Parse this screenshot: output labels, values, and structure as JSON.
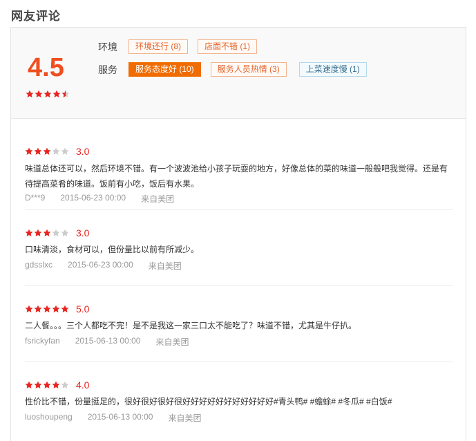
{
  "section": {
    "title": "网友评论"
  },
  "summary": {
    "score": "4.5",
    "score_rating": 4.5,
    "categories": [
      {
        "label": "环境",
        "tags": [
          {
            "text": "环境还行 (8)",
            "state": "normal"
          },
          {
            "text": "店面不错 (1)",
            "state": "normal"
          }
        ]
      },
      {
        "label": "服务",
        "tags": [
          {
            "text": "服务态度好 (10)",
            "state": "active"
          },
          {
            "text": "服务人员热情 (3)",
            "state": "normal"
          },
          {
            "text": "上菜速度慢 (1)",
            "state": "negative"
          }
        ]
      }
    ]
  },
  "reviews": [
    {
      "rating": 3,
      "rating_text": "3.0",
      "text": "味道总体还可以，然后环境不错。有一个波波池给小孩子玩耍的地方，好像总体的菜的味道一般般吧我觉得。还是有待提高菜肴的味道。饭前有小吃，饭后有水果。",
      "user": "D***9",
      "date": "2015-06-23 00:00",
      "source": "来自美团"
    },
    {
      "rating": 3,
      "rating_text": "3.0",
      "text": "口味清淡，食材可以，但份量比以前有所减少。",
      "user": "gdsslxc",
      "date": "2015-06-23 00:00",
      "source": "来自美团"
    },
    {
      "rating": 5,
      "rating_text": "5.0",
      "text": "二人餐。。。三个人都吃不完！是不是我这一家三口太不能吃了？味道不错，尤其是牛仔扒。",
      "user": "fsrickyfan",
      "date": "2015-06-13 00:00",
      "source": "来自美团"
    },
    {
      "rating": 4,
      "rating_text": "4.0",
      "text": "性价比不错，份量挺足的，很好很好很好很好好好好好好好好好好好#青头鸭# #蟾蜍# #冬瓜# #白饭#",
      "user": "luoshoupeng",
      "date": "2015-06-13 00:00",
      "source": "来自美团"
    }
  ],
  "colors": {
    "star_filled": "#e8251f",
    "star_empty": "#cccccc",
    "accent": "#f06c00"
  }
}
